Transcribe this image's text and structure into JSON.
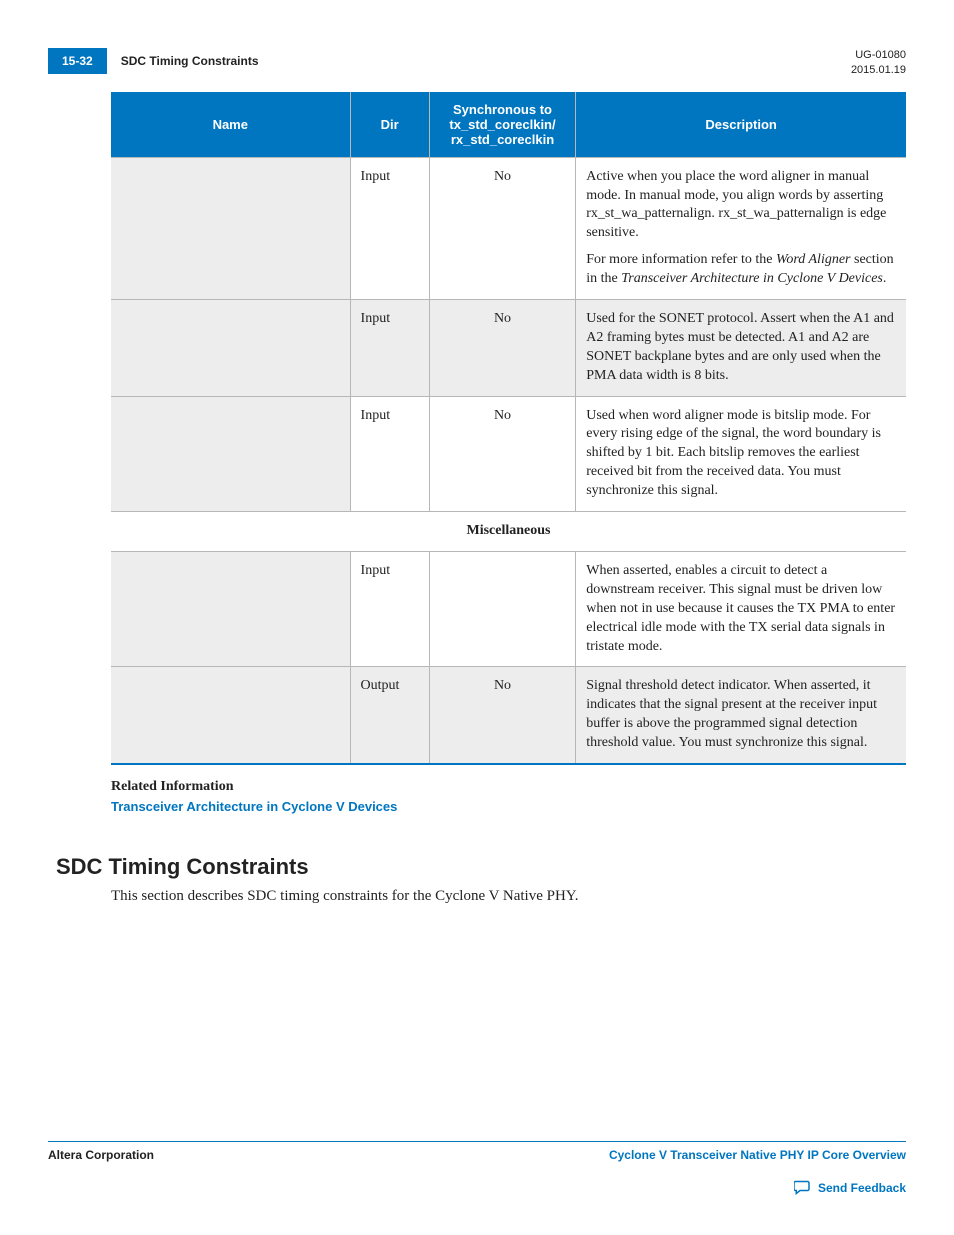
{
  "header": {
    "page_number": "15-32",
    "breadcrumb": "SDC Timing Constraints",
    "doc_id": "UG-01080",
    "doc_date": "2015.01.19"
  },
  "table": {
    "headers": {
      "name": "Name",
      "dir": "Dir",
      "sync": "Synchronous to tx_std_coreclkin/ rx_std_coreclkin",
      "desc": "Description"
    },
    "rows": [
      {
        "dir": "Input",
        "sync": "No",
        "desc_p1_a": "Active when you place the word aligner in manual mode. In manual mode, you align words by asserting rx_st_wa_patternalign. rx_st_wa_patternalign is edge sensitive.",
        "desc_p2_a": "For more information refer to the ",
        "desc_p2_i1": "Word Aligner",
        "desc_p2_b": " section in the ",
        "desc_p2_i2": "Transceiver Architecture in Cyclone V Devices",
        "desc_p2_c": "."
      },
      {
        "dir": "Input",
        "sync": "No",
        "desc": "Used for the SONET protocol. Assert when the A1 and A2 framing bytes must be detected. A1 and A2 are SONET backplane bytes and are only used when the PMA data width is 8 bits."
      },
      {
        "dir": "Input",
        "sync": "No",
        "desc": "Used when word aligner mode is bitslip mode. For every rising edge of the                   signal, the word boundary is shifted by 1 bit. Each bitslip removes the earliest received bit from the received data. You must synchronize this signal."
      },
      {
        "section": "Miscellaneous"
      },
      {
        "dir": "Input",
        "sync": "",
        "desc": "When asserted, enables a circuit to detect a downstream receiver. This signal must be driven low when not in use because it causes the TX PMA to enter electrical idle mode with the TX serial data signals in tristate mode."
      },
      {
        "dir": "Output",
        "sync": "No",
        "desc": "Signal threshold detect indicator. When asserted, it indicates that the signal present at the receiver input buffer is above the programmed signal detection threshold value. You must synchronize this signal."
      }
    ]
  },
  "related": {
    "heading": "Related Information",
    "link_text": "Transceiver Architecture in Cyclone V Devices"
  },
  "section": {
    "title": "SDC Timing Constraints",
    "body": "This section describes SDC timing constraints for the Cyclone V Native PHY."
  },
  "footer": {
    "left": "Altera Corporation",
    "right": "Cyclone V Transceiver Native PHY IP Core Overview",
    "feedback": "Send Feedback"
  }
}
